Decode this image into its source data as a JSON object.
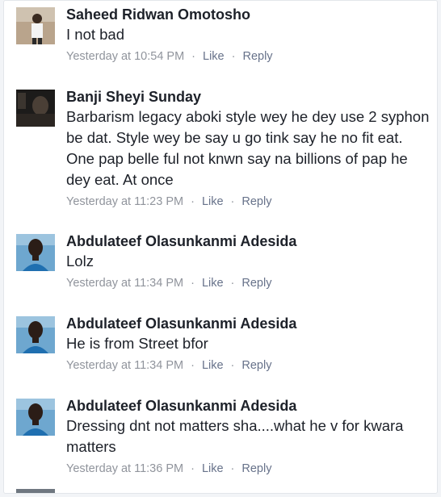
{
  "comments": [
    {
      "author": "Saheed Ridwan Omotosho",
      "text": "I not bad",
      "time": "Yesterday at 10:54 PM",
      "like_label": "Like",
      "reply_label": "Reply",
      "avatar_icon": "profile-photo"
    },
    {
      "author": "Banji Sheyi Sunday",
      "text": "Barbarism legacy aboki style wey he dey use 2 syphon be dat. Style wey be say u go tink say he no fit eat. One pap belle ful not knwn say na billions of pap he dey eat. At once",
      "time": "Yesterday at 11:23 PM",
      "like_label": "Like",
      "reply_label": "Reply",
      "avatar_icon": "profile-photo"
    },
    {
      "author": "Abdulateef Olasunkanmi Adesida",
      "text": "Lolz",
      "time": "Yesterday at 11:34 PM",
      "like_label": "Like",
      "reply_label": "Reply",
      "avatar_icon": "profile-photo"
    },
    {
      "author": "Abdulateef Olasunkanmi Adesida",
      "text": "He is from Street bfor",
      "time": "Yesterday at 11:34 PM",
      "like_label": "Like",
      "reply_label": "Reply",
      "avatar_icon": "profile-photo"
    },
    {
      "author": "Abdulateef Olasunkanmi Adesida",
      "text": "Dressing dnt not matters sha....what he v for kwara matters",
      "time": "Yesterday at 11:36 PM",
      "like_label": "Like",
      "reply_label": "Reply",
      "avatar_icon": "profile-photo"
    }
  ],
  "meta_separator": "·",
  "colors": {
    "name_text": "#1d2129",
    "meta_text": "#90949c",
    "action_text": "#67728a",
    "background": "#ffffff"
  }
}
